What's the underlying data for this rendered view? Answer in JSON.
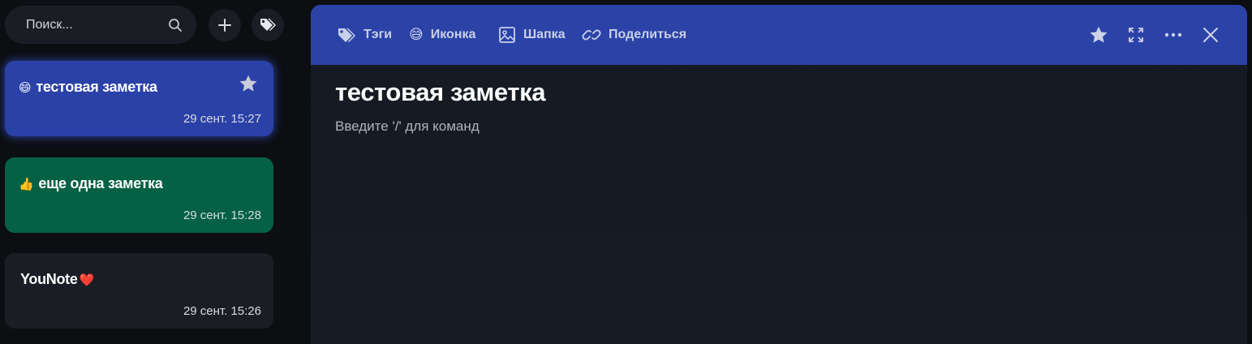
{
  "search": {
    "placeholder": "Поиск...",
    "icon": "search-icon"
  },
  "sidebar_actions": [
    {
      "icon": "plus-icon"
    },
    {
      "icon": "tags-icon"
    }
  ],
  "notes": [
    {
      "emoji": "😄",
      "title": "тестовая заметка",
      "date": "29 сент. 15:27",
      "color": "#2a41a8",
      "starred": true,
      "active": true
    },
    {
      "emoji": "👍",
      "title": "еще одна заметка",
      "date": "29 сент. 15:28",
      "color": "#046144",
      "starred": false,
      "active": false
    },
    {
      "emoji": "",
      "title": "YouNote",
      "title_suffix": "❤️",
      "date": "29 сент. 15:26",
      "color": "#1a1d24",
      "starred": false,
      "active": false
    }
  ],
  "toolbar": {
    "tags_label": "Тэги",
    "icon_label": "Иконка",
    "icon_emoji": "😅",
    "cover_label": "Шапка",
    "share_label": "Поделиться",
    "right_icons": [
      "star-icon",
      "expand-icon",
      "more-icon",
      "close-icon"
    ],
    "color": "#2b43a7"
  },
  "document": {
    "title": "тестовая заметка",
    "hint": "Введите '/' для команд"
  }
}
